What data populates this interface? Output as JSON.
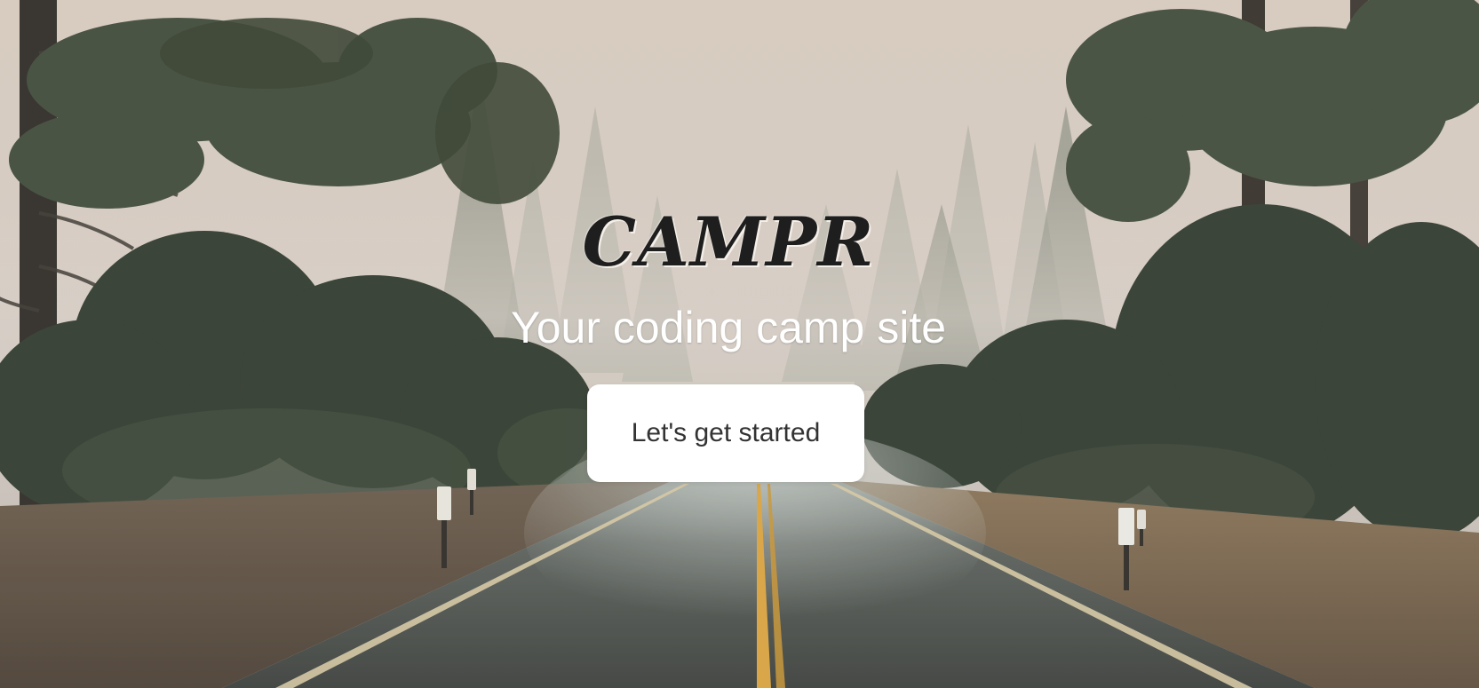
{
  "hero": {
    "title": "CAMPR",
    "tagline": "Your coding camp site",
    "cta_label": "Let's get started",
    "background_scene": "foggy-forest-wet-road"
  },
  "colors": {
    "title_text": "#1e1e1e",
    "tagline_text": "#ffffff",
    "button_bg": "#ffffff",
    "button_text": "#333333",
    "sky": "#d9cfc3",
    "road_line": "#d9a441"
  }
}
